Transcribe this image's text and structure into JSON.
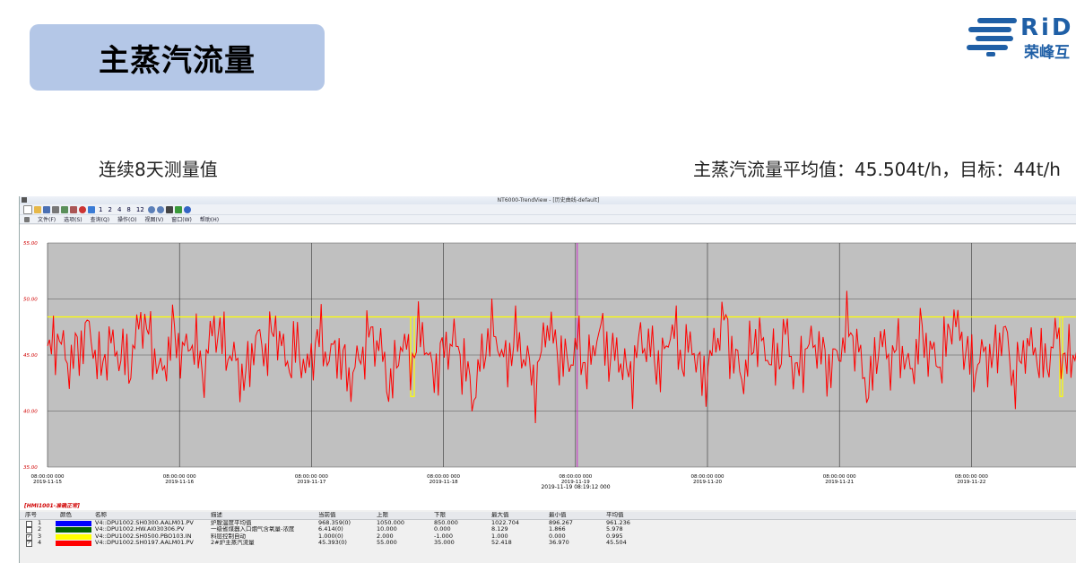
{
  "slide": {
    "title": "主蒸汽流量",
    "subtitle_left": "连续8天测量值",
    "subtitle_right": "主蒸汽流量平均值：45.504t/h，目标：44t/h"
  },
  "logo": {
    "text": "RiD",
    "cn_text": "荣峰互",
    "mark_color": "#1f5fa6"
  },
  "window": {
    "title": "NT6000-TrendView - [历史曲线-default]",
    "toolbar_numbers": [
      "1",
      "2",
      "4",
      "8",
      "12"
    ],
    "menu": [
      "文件(F)",
      "选项(S)",
      "查询(Q)",
      "操作(O)",
      "视图(V)",
      "窗口(W)",
      "帮助(H)"
    ]
  },
  "chart_data": {
    "type": "line",
    "y_ticks": [
      "55.00",
      "50.00",
      "45.00",
      "40.00",
      "35.00"
    ],
    "ylim": [
      35,
      55
    ],
    "x_tick_times": [
      "08:00:00 000",
      "08:00:00 000",
      "08:00:00 000",
      "08:00:00 000",
      "08:00:00 000",
      "08:00:00 000",
      "08:00:00 000",
      "08:00:00 000",
      "08:00:00 000"
    ],
    "x_tick_dates": [
      "2019-11-15",
      "2019-11-16",
      "2019-11-17",
      "2019-11-18",
      "2019-11-19",
      "2019-11-20",
      "2019-11-21",
      "2019-11-22",
      ""
    ],
    "cursor_label": "2019-11-19 08:19:12 000",
    "target_line": 48.4,
    "background": "#c0c0c0",
    "series": [
      {
        "color": "#ff0000",
        "values": [
          44.9,
          46.8,
          44.1,
          45.6,
          47.4,
          43.6,
          46.1,
          45.0,
          44.2,
          48.6,
          46.0,
          42.9,
          47.1,
          45.1,
          46.4,
          43.3,
          47.9,
          45.8,
          44.5,
          42.6,
          46.6,
          45.3,
          47.7,
          44.0,
          45.9,
          43.4,
          46.9,
          44.8,
          45.5,
          42.7,
          44.6,
          47.0,
          45.7,
          41.8,
          46.3,
          44.4,
          47.6,
          43.1,
          45.2,
          46.5,
          44.3,
          41.2,
          45.8,
          47.3,
          43.9,
          46.7,
          44.6,
          42.2,
          48.2,
          45.4,
          44.1,
          46.0,
          43.5,
          47.5,
          45.1,
          44.9,
          42.8,
          46.4,
          45.6,
          43.7,
          47.8,
          44.5,
          46.2,
          42.5,
          45.3,
          48.5,
          44.7,
          43.0,
          46.8,
          45.5,
          44.0,
          47.2,
          42.9,
          45.7,
          46.1,
          43.8,
          44.8,
          47.7,
          45.2,
          41.5,
          46.6,
          44.4,
          45.9,
          43.2,
          47.0,
          45.0,
          44.2,
          48.4,
          46.3,
          43.6,
          45.1,
          44.7,
          47.4,
          42.4,
          46.0,
          45.4,
          43.9,
          46.9,
          44.1,
          45.8
        ]
      },
      {
        "color": "#ffff00",
        "values": [
          48.4
        ]
      }
    ]
  },
  "legend": {
    "title": "[HMI1001-准确正常]",
    "headers": [
      "序号",
      "颜色",
      "名称",
      "描述",
      "当前值",
      "上限",
      "下限",
      "最大值",
      "最小值",
      "平均值"
    ],
    "rows": [
      {
        "index": "1",
        "checked": "",
        "color": "#0000ff",
        "name": "V4::DPU1002.SH0300.AALM01.PV",
        "desc": "炉膛温度平均值",
        "current": "968.359(0)",
        "upper": "1050.000",
        "lower": "850.000",
        "max": "1022.704",
        "min": "896.267",
        "avg": "961.236"
      },
      {
        "index": "2",
        "checked": "",
        "color": "#006400",
        "name": "V4::DPU1002.HW.AI030306.PV",
        "desc": "一级省煤器入口烟气含氧量-浓度",
        "current": "6.414(0)",
        "upper": "10.000",
        "lower": "0.000",
        "max": "8.129",
        "min": "1.866",
        "avg": "5.978"
      },
      {
        "index": "3",
        "checked": "✓",
        "color": "#ffff00",
        "name": "V4::DPU1002.SH0500.PBO103.IN",
        "desc": "料层控制自动",
        "current": "1.000(0)",
        "upper": "2.000",
        "lower": "-1.000",
        "max": "1.000",
        "min": "0.000",
        "avg": "0.995"
      },
      {
        "index": "4",
        "checked": "✓",
        "color": "#ff0000",
        "name": "V4::DPU1002.SH0197.AALM01.PV",
        "desc": "2#炉主蒸汽流量",
        "current": "45.393(0)",
        "upper": "55.000",
        "lower": "35.000",
        "max": "52.418",
        "min": "36.970",
        "avg": "45.504"
      }
    ]
  }
}
